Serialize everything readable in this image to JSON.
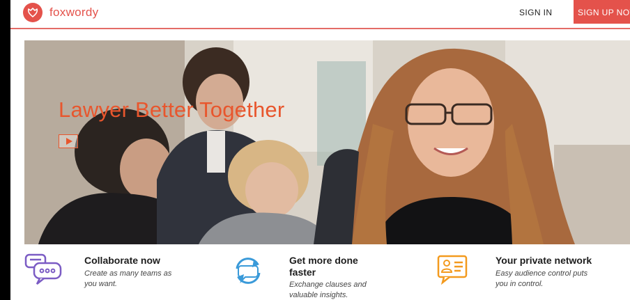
{
  "header": {
    "logo_text": "foxwordy",
    "signin_label": "SIGN IN",
    "signup_label": "SIGN UP NOW"
  },
  "hero": {
    "title": "Lawyer Better Together",
    "play_icon": "play-icon"
  },
  "features": [
    {
      "icon": "chat-bubbles-icon",
      "title": "Collaborate now",
      "desc_line1": "Create as many teams as",
      "desc_line2": "you want."
    },
    {
      "icon": "refresh-arrows-icon",
      "title_line1": "Get more done",
      "title_line2": "faster",
      "desc_line1": "Exchange clauses and",
      "desc_line2": "valuable insights."
    },
    {
      "icon": "contact-card-icon",
      "title": "Your private network",
      "desc_line1": "Easy audience control puts",
      "desc_line2": "you in control."
    }
  ],
  "colors": {
    "brand": "#e4524b",
    "hero_title": "#e8562d",
    "feature_icon_1": "#7b5cc4",
    "feature_icon_2": "#3a9ad9",
    "feature_icon_3": "#f39a1e"
  }
}
